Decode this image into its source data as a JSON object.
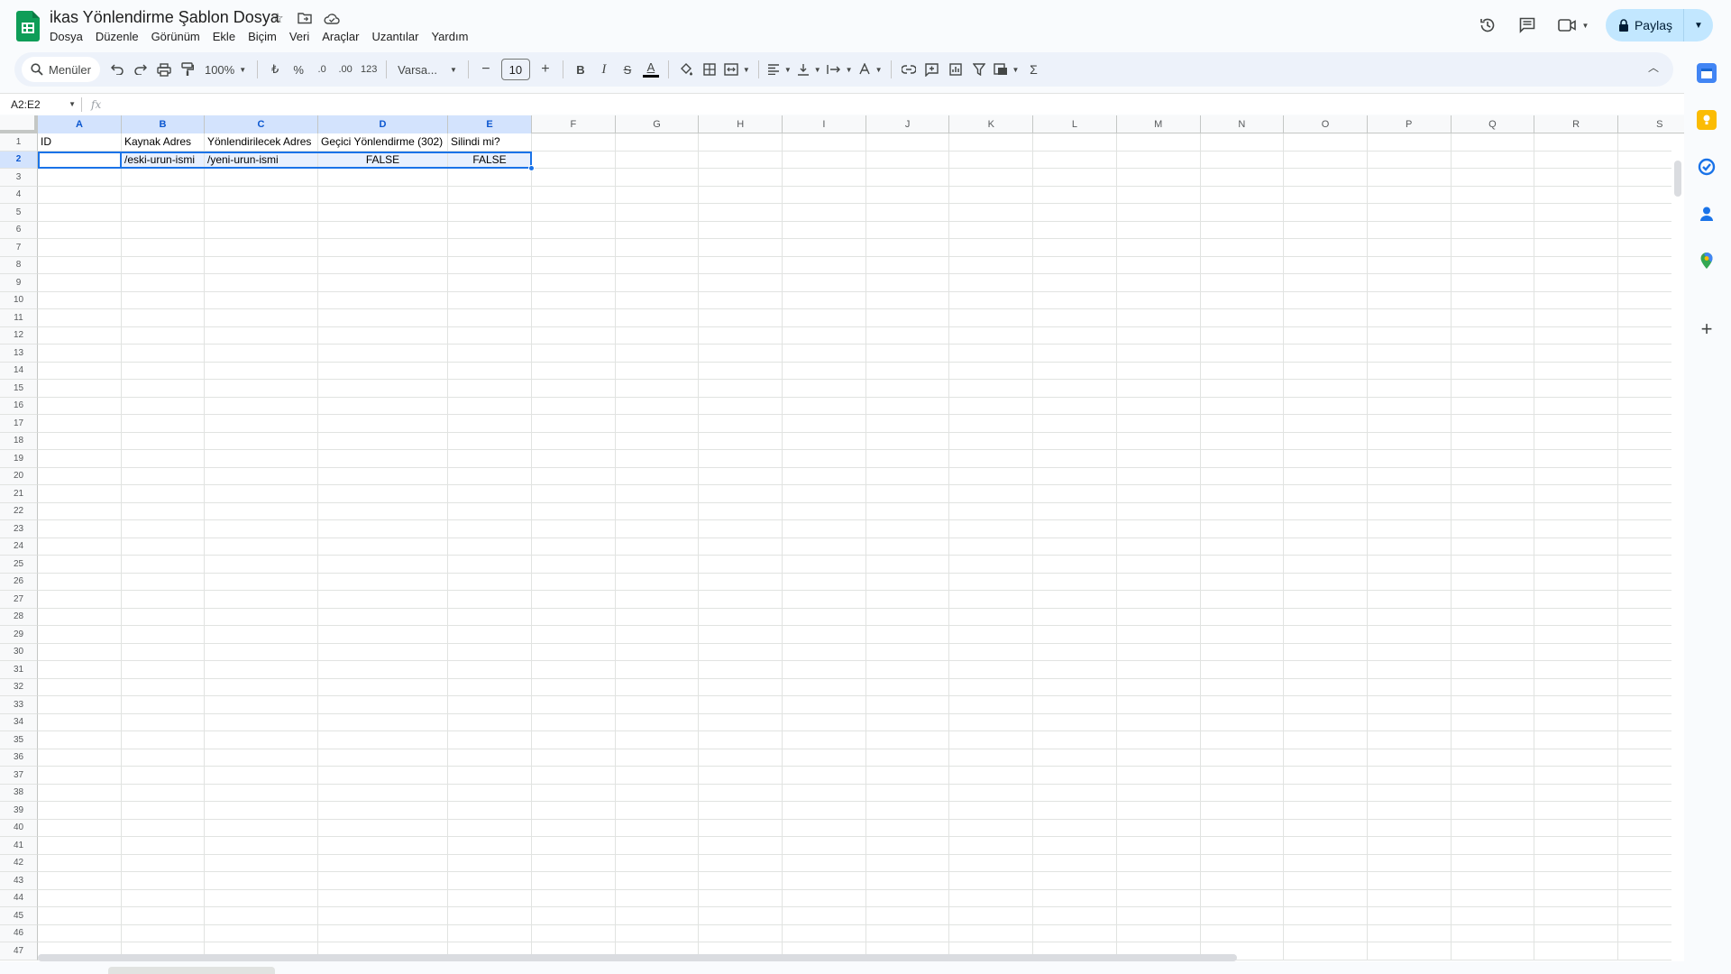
{
  "app": {
    "title": "ikas Yönlendirme Şablon Dosya",
    "menu": [
      "Dosya",
      "Düzenle",
      "Görünüm",
      "Ekle",
      "Biçim",
      "Veri",
      "Araçlar",
      "Uzantılar",
      "Yardım"
    ],
    "title_icons": [
      "star-icon",
      "move-folder-icon",
      "cloud-saved-icon"
    ]
  },
  "top_right": {
    "share_label": "Paylaş",
    "icons": [
      "history-icon",
      "comments-icon",
      "meet-icon"
    ]
  },
  "toolbar": {
    "search_label": "Menüler",
    "zoom": "100%",
    "currency": "₺",
    "percent": "%",
    "decrease_decimal": ".0",
    "increase_decimal": ".00",
    "number_format": "123",
    "font": "Varsa...",
    "font_size": "10",
    "bold": "B",
    "italic": "I",
    "strikethrough": "S",
    "text_color": "A",
    "sum": "Σ"
  },
  "formula_bar": {
    "name_box": "A2:E2",
    "fx": "fx",
    "content": ""
  },
  "sheet": {
    "columns": [
      "A",
      "B",
      "C",
      "D",
      "E",
      "F",
      "G",
      "H",
      "I",
      "J",
      "K",
      "L",
      "M",
      "N",
      "O",
      "P",
      "Q",
      "R",
      "S"
    ],
    "selected_columns": [
      "A",
      "B",
      "C",
      "D",
      "E"
    ],
    "selected_row": 2,
    "row_count": 47,
    "cells": {
      "A1": "ID",
      "B1": "Kaynak Adres",
      "C1": "Yönlendirilecek Adres",
      "D1": "Geçici Yönlendirme (302)",
      "E1": "Silindi mi?",
      "A2": "",
      "B2": "/eski-urun-ismi",
      "C2": "/yeni-urun-ismi",
      "D2": "FALSE",
      "E2": "FALSE"
    }
  },
  "side_panel": {
    "icons": [
      "calendar-icon",
      "keep-icon",
      "tasks-icon",
      "contacts-icon",
      "maps-icon",
      "add-icon"
    ],
    "colors": {
      "calendar": "#4285f4",
      "keep": "#fbbc04",
      "tasks": "#1a73e8",
      "contacts": "#1a73e8",
      "maps": "#34a853"
    }
  },
  "colors": {
    "accent": "#1a73e8",
    "share_bg": "#c2e7ff",
    "sheets_green": "#0f9d58",
    "selection_fill": "#e8f0fe"
  }
}
